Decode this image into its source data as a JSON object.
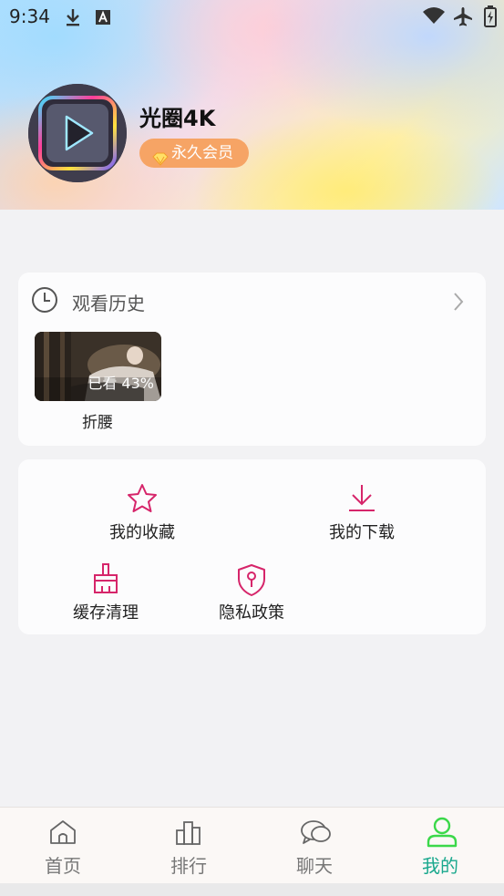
{
  "status_bar": {
    "time": "9:34",
    "left_icons": [
      "download-icon",
      "a-notification-icon"
    ],
    "right_icons": [
      "wifi-icon",
      "airplane-icon",
      "battery-charging-icon"
    ]
  },
  "profile": {
    "app_name": "光圈4K",
    "vip_label": "永久会员",
    "vip_icon": "diamond-icon",
    "badge_color": "#f6a465"
  },
  "history": {
    "title": "观看历史",
    "icon": "clock-icon",
    "items": [
      {
        "title": "折腰",
        "progress_text": "已看 43%"
      }
    ]
  },
  "menu": {
    "accent_color": "#d6256a",
    "items": [
      {
        "label": "我的收藏",
        "icon": "star-icon"
      },
      {
        "label": "我的下载",
        "icon": "download-icon"
      },
      {
        "label": "缓存清理",
        "icon": "broom-icon"
      },
      {
        "label": "隐私政策",
        "icon": "shield-icon"
      }
    ]
  },
  "bottom_nav": {
    "active_color": "#19a88d",
    "items": [
      {
        "label": "首页",
        "icon": "home-icon",
        "active": false
      },
      {
        "label": "排行",
        "icon": "ranking-icon",
        "active": false
      },
      {
        "label": "聊天",
        "icon": "chat-icon",
        "active": false
      },
      {
        "label": "我的",
        "icon": "user-icon",
        "active": true
      }
    ]
  }
}
